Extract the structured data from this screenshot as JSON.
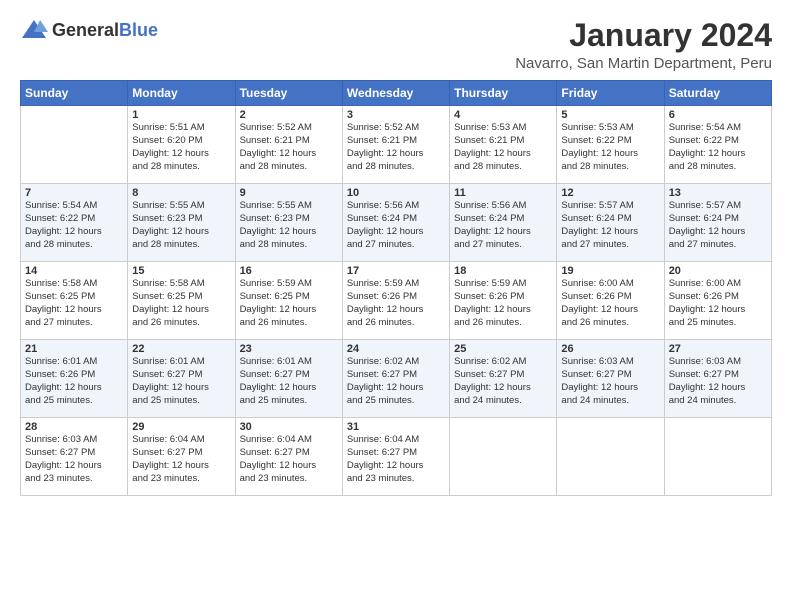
{
  "header": {
    "logo_general": "General",
    "logo_blue": "Blue",
    "title": "January 2024",
    "location": "Navarro, San Martin Department, Peru"
  },
  "days_of_week": [
    "Sunday",
    "Monday",
    "Tuesday",
    "Wednesday",
    "Thursday",
    "Friday",
    "Saturday"
  ],
  "weeks": [
    [
      {
        "day": "",
        "content": ""
      },
      {
        "day": "1",
        "content": "Sunrise: 5:51 AM\nSunset: 6:20 PM\nDaylight: 12 hours\nand 28 minutes."
      },
      {
        "day": "2",
        "content": "Sunrise: 5:52 AM\nSunset: 6:21 PM\nDaylight: 12 hours\nand 28 minutes."
      },
      {
        "day": "3",
        "content": "Sunrise: 5:52 AM\nSunset: 6:21 PM\nDaylight: 12 hours\nand 28 minutes."
      },
      {
        "day": "4",
        "content": "Sunrise: 5:53 AM\nSunset: 6:21 PM\nDaylight: 12 hours\nand 28 minutes."
      },
      {
        "day": "5",
        "content": "Sunrise: 5:53 AM\nSunset: 6:22 PM\nDaylight: 12 hours\nand 28 minutes."
      },
      {
        "day": "6",
        "content": "Sunrise: 5:54 AM\nSunset: 6:22 PM\nDaylight: 12 hours\nand 28 minutes."
      }
    ],
    [
      {
        "day": "7",
        "content": "Sunrise: 5:54 AM\nSunset: 6:22 PM\nDaylight: 12 hours\nand 28 minutes."
      },
      {
        "day": "8",
        "content": "Sunrise: 5:55 AM\nSunset: 6:23 PM\nDaylight: 12 hours\nand 28 minutes."
      },
      {
        "day": "9",
        "content": "Sunrise: 5:55 AM\nSunset: 6:23 PM\nDaylight: 12 hours\nand 28 minutes."
      },
      {
        "day": "10",
        "content": "Sunrise: 5:56 AM\nSunset: 6:24 PM\nDaylight: 12 hours\nand 27 minutes."
      },
      {
        "day": "11",
        "content": "Sunrise: 5:56 AM\nSunset: 6:24 PM\nDaylight: 12 hours\nand 27 minutes."
      },
      {
        "day": "12",
        "content": "Sunrise: 5:57 AM\nSunset: 6:24 PM\nDaylight: 12 hours\nand 27 minutes."
      },
      {
        "day": "13",
        "content": "Sunrise: 5:57 AM\nSunset: 6:24 PM\nDaylight: 12 hours\nand 27 minutes."
      }
    ],
    [
      {
        "day": "14",
        "content": "Sunrise: 5:58 AM\nSunset: 6:25 PM\nDaylight: 12 hours\nand 27 minutes."
      },
      {
        "day": "15",
        "content": "Sunrise: 5:58 AM\nSunset: 6:25 PM\nDaylight: 12 hours\nand 26 minutes."
      },
      {
        "day": "16",
        "content": "Sunrise: 5:59 AM\nSunset: 6:25 PM\nDaylight: 12 hours\nand 26 minutes."
      },
      {
        "day": "17",
        "content": "Sunrise: 5:59 AM\nSunset: 6:26 PM\nDaylight: 12 hours\nand 26 minutes."
      },
      {
        "day": "18",
        "content": "Sunrise: 5:59 AM\nSunset: 6:26 PM\nDaylight: 12 hours\nand 26 minutes."
      },
      {
        "day": "19",
        "content": "Sunrise: 6:00 AM\nSunset: 6:26 PM\nDaylight: 12 hours\nand 26 minutes."
      },
      {
        "day": "20",
        "content": "Sunrise: 6:00 AM\nSunset: 6:26 PM\nDaylight: 12 hours\nand 25 minutes."
      }
    ],
    [
      {
        "day": "21",
        "content": "Sunrise: 6:01 AM\nSunset: 6:26 PM\nDaylight: 12 hours\nand 25 minutes."
      },
      {
        "day": "22",
        "content": "Sunrise: 6:01 AM\nSunset: 6:27 PM\nDaylight: 12 hours\nand 25 minutes."
      },
      {
        "day": "23",
        "content": "Sunrise: 6:01 AM\nSunset: 6:27 PM\nDaylight: 12 hours\nand 25 minutes."
      },
      {
        "day": "24",
        "content": "Sunrise: 6:02 AM\nSunset: 6:27 PM\nDaylight: 12 hours\nand 25 minutes."
      },
      {
        "day": "25",
        "content": "Sunrise: 6:02 AM\nSunset: 6:27 PM\nDaylight: 12 hours\nand 24 minutes."
      },
      {
        "day": "26",
        "content": "Sunrise: 6:03 AM\nSunset: 6:27 PM\nDaylight: 12 hours\nand 24 minutes."
      },
      {
        "day": "27",
        "content": "Sunrise: 6:03 AM\nSunset: 6:27 PM\nDaylight: 12 hours\nand 24 minutes."
      }
    ],
    [
      {
        "day": "28",
        "content": "Sunrise: 6:03 AM\nSunset: 6:27 PM\nDaylight: 12 hours\nand 23 minutes."
      },
      {
        "day": "29",
        "content": "Sunrise: 6:04 AM\nSunset: 6:27 PM\nDaylight: 12 hours\nand 23 minutes."
      },
      {
        "day": "30",
        "content": "Sunrise: 6:04 AM\nSunset: 6:27 PM\nDaylight: 12 hours\nand 23 minutes."
      },
      {
        "day": "31",
        "content": "Sunrise: 6:04 AM\nSunset: 6:27 PM\nDaylight: 12 hours\nand 23 minutes."
      },
      {
        "day": "",
        "content": ""
      },
      {
        "day": "",
        "content": ""
      },
      {
        "day": "",
        "content": ""
      }
    ]
  ]
}
